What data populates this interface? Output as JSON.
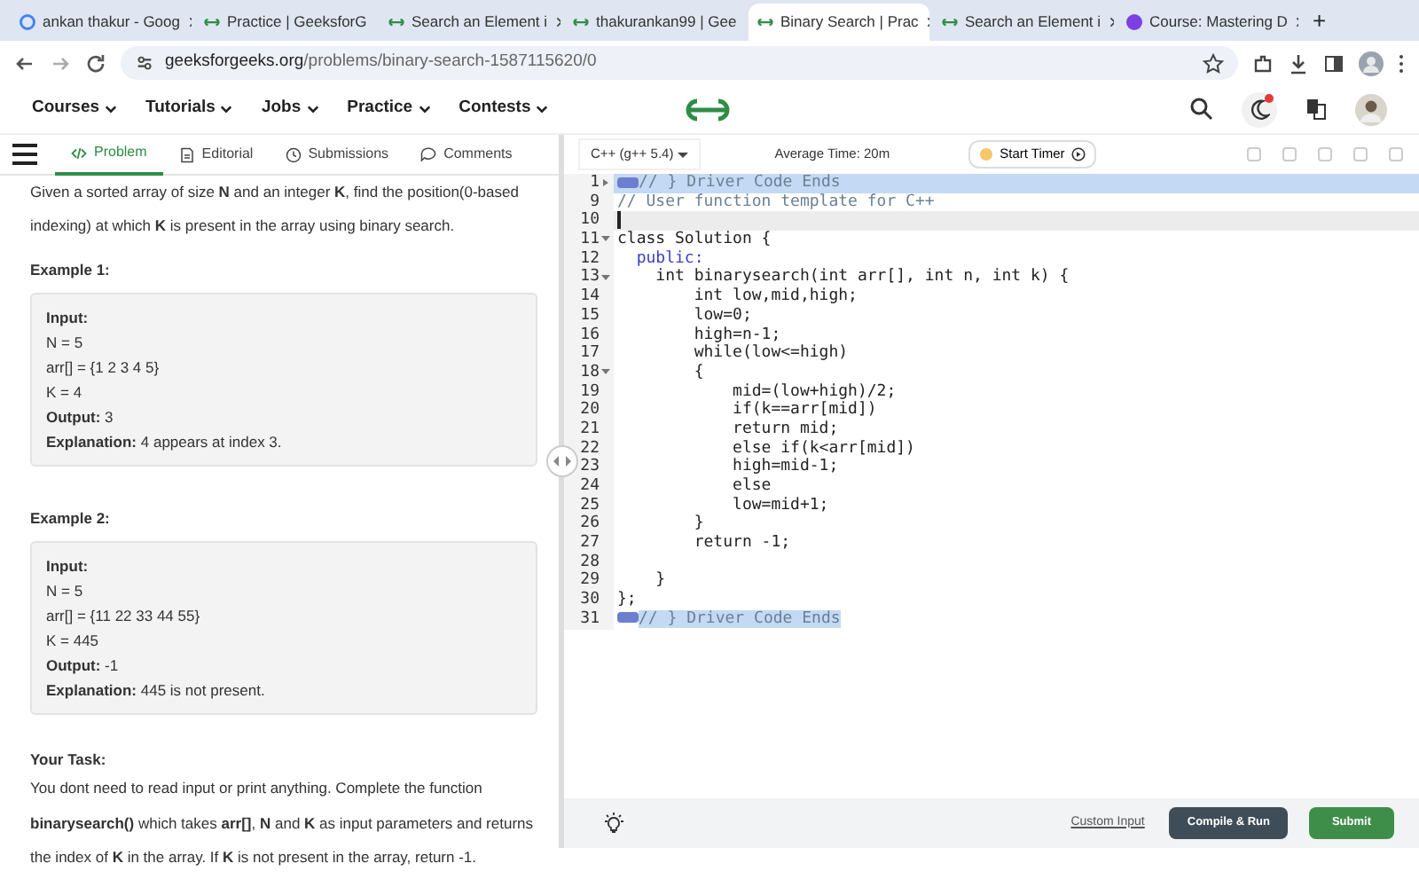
{
  "browser": {
    "tabs": [
      {
        "title": "ankan thakur - Goog",
        "kind": "google",
        "selected": false
      },
      {
        "title": "Practice | GeeksforG",
        "kind": "gfg",
        "selected": false
      },
      {
        "title": "Search an Element i",
        "kind": "gfg",
        "selected": false
      },
      {
        "title": "thakurankan99 | Gee",
        "kind": "gfg",
        "selected": false
      },
      {
        "title": "Binary Search | Prac",
        "kind": "gfg",
        "selected": true
      },
      {
        "title": "Search an Element i",
        "kind": "gfg",
        "selected": false
      },
      {
        "title": "Course: Mastering D",
        "kind": "course",
        "selected": false
      }
    ],
    "new_tab": "+",
    "url_host": "geeksforgeeks.org",
    "url_path": "/problems/binary-search-1587115620/0"
  },
  "site_nav": {
    "items": [
      "Courses",
      "Tutorials",
      "Jobs",
      "Practice",
      "Contests"
    ],
    "notification": true
  },
  "problem_tabs": [
    {
      "label": "Problem",
      "kind": "code",
      "selected": true
    },
    {
      "label": "Editorial",
      "kind": "doc",
      "selected": false
    },
    {
      "label": "Submissions",
      "kind": "clock",
      "selected": false
    },
    {
      "label": "Comments",
      "kind": "chat",
      "selected": false
    }
  ],
  "problem": {
    "description": "Given a sorted array of size **N** and an integer **K**, find the position(0-based indexing) at which **K** is present in the array using binary search.",
    "examples": [
      {
        "title": "Example 1:",
        "lines": [
          "**Input:**",
          "N = 5",
          "arr[] = {1 2 3 4 5}",
          "K = 4",
          "**Output:** 3",
          "**Explanation:** 4 appears at index 3."
        ]
      },
      {
        "title": "Example 2:",
        "lines": [
          "**Input:**",
          "N = 5",
          "arr[] = {11 22 33 44 55}",
          "K = 445",
          "**Output:** -1",
          "**Explanation:** 445 is not present."
        ]
      }
    ],
    "task_title": "Your Task:",
    "task_text": "You dont need to read input or print anything. Complete the function **binarysearch()** which takes **arr[]**, **N** and **K** as input parameters and returns the index of **K** in the array. If **K** is not present in the array, return -1."
  },
  "editor": {
    "language": "C++ (g++ 5.4)",
    "average_time": "Average Time: 20m",
    "timer_button": "Start Timer",
    "lines": [
      {
        "number": "1",
        "expanded": false,
        "folded": true,
        "kind": "comment",
        "code": "// } Driver Code Ends",
        "selected": true,
        "current": false
      },
      {
        "number": "9",
        "kind": "comment",
        "code": "// User function template for C++",
        "selected": false,
        "current": false
      },
      {
        "number": "10",
        "selected": false,
        "current": true
      },
      {
        "number": "11",
        "expanded": true,
        "kind": "code",
        "code": "class Solution {"
      },
      {
        "number": "12",
        "kind": "keyword",
        "code": "  public:"
      },
      {
        "number": "13",
        "expanded": true,
        "kind": "code",
        "code": "    int binarysearch(int arr[], int n, int k) {"
      },
      {
        "number": "14",
        "kind": "code",
        "code": "        int low,mid,high;"
      },
      {
        "number": "15",
        "kind": "code",
        "code": "        low=0;"
      },
      {
        "number": "16",
        "kind": "code",
        "code": "        high=n-1;"
      },
      {
        "number": "17",
        "kind": "code",
        "code": "        while(low<=high)"
      },
      {
        "number": "18",
        "expanded": true,
        "kind": "code",
        "code": "        {"
      },
      {
        "number": "19",
        "kind": "code",
        "code": "            mid=(low+high)/2;"
      },
      {
        "number": "20",
        "kind": "code",
        "code": "            if(k==arr[mid])"
      },
      {
        "number": "21",
        "kind": "code",
        "code": "            return mid;"
      },
      {
        "number": "22",
        "kind": "code",
        "code": "            else if(k<arr[mid])"
      },
      {
        "number": "23",
        "kind": "code",
        "code": "            high=mid-1;"
      },
      {
        "number": "24",
        "kind": "code",
        "code": "            else"
      },
      {
        "number": "25",
        "kind": "code",
        "code": "            low=mid+1;"
      },
      {
        "number": "26",
        "kind": "code",
        "code": "        }"
      },
      {
        "number": "27",
        "kind": "code",
        "code": "        return -1;"
      },
      {
        "number": "28"
      },
      {
        "number": "29",
        "kind": "code",
        "code": "    }"
      },
      {
        "number": "30",
        "kind": "code",
        "code": "};"
      },
      {
        "number": "31",
        "folded": true,
        "kind": "comment",
        "code": "// } Driver Code Ends",
        "selected": true,
        "current": false
      }
    ]
  },
  "footer": {
    "custom_input": "Custom Input",
    "compile": "Compile & Run",
    "submit": "Submit"
  }
}
